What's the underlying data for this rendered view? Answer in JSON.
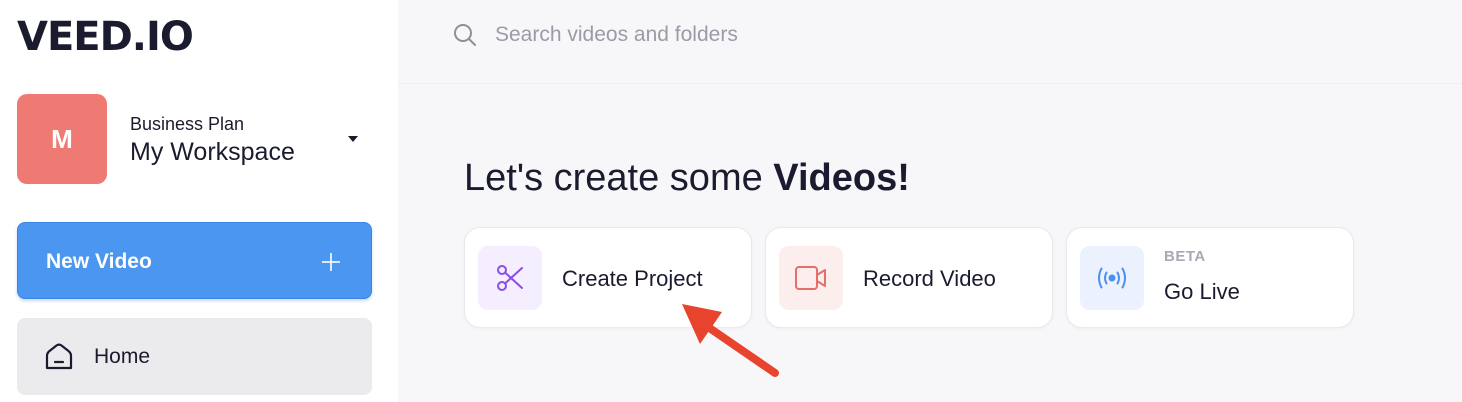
{
  "brand": {
    "logo_text": "VEED.IO"
  },
  "workspace": {
    "avatar_letter": "M",
    "plan": "Business Plan",
    "name": "My Workspace",
    "avatar_color": "#ef7a73"
  },
  "sidebar": {
    "new_video_label": "New Video",
    "items": [
      {
        "label": "Home",
        "icon": "home-icon",
        "active": true
      }
    ]
  },
  "search": {
    "placeholder": "Search videos and folders",
    "value": ""
  },
  "main": {
    "heading_prefix": "Let's create some ",
    "heading_bold": "Videos!",
    "cards": [
      {
        "label": "Create Project",
        "icon": "scissors-icon",
        "badge": "",
        "icon_bg": "#f4eefe",
        "icon_color": "#8a4ee8"
      },
      {
        "label": "Record Video",
        "icon": "video-camera-icon",
        "badge": "",
        "icon_bg": "#fdeeee",
        "icon_color": "#e46f6a"
      },
      {
        "label": "Go Live",
        "icon": "broadcast-icon",
        "badge": "BETA",
        "icon_bg": "#ecf2fd",
        "icon_color": "#4b8ff0"
      }
    ]
  },
  "colors": {
    "accent": "#4b96f0",
    "annotation_arrow": "#e8432d"
  }
}
